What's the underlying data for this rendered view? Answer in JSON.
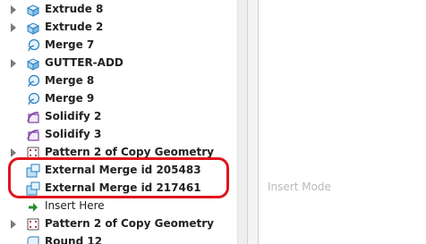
{
  "tree": {
    "rows": [
      {
        "label": "Extrude 8",
        "icon": "extrude-icon",
        "expandable": true
      },
      {
        "label": "Extrude 2",
        "icon": "extrude-icon",
        "expandable": true
      },
      {
        "label": "Merge 7",
        "icon": "merge-icon",
        "expandable": false
      },
      {
        "label": "GUTTER-ADD",
        "icon": "extrude-icon",
        "expandable": true
      },
      {
        "label": "Merge 8",
        "icon": "merge-icon",
        "expandable": false
      },
      {
        "label": "Merge 9",
        "icon": "merge-icon",
        "expandable": false
      },
      {
        "label": "Solidify 2",
        "icon": "solidify-icon",
        "expandable": false
      },
      {
        "label": "Solidify 3",
        "icon": "solidify-icon",
        "expandable": false
      },
      {
        "label": "Pattern 2 of Copy Geometry",
        "icon": "pattern-icon",
        "expandable": true
      },
      {
        "label": "External Merge id 205483",
        "icon": "external-merge-icon",
        "expandable": false
      },
      {
        "label": "External Merge id 217461",
        "icon": "external-merge-icon",
        "expandable": false
      },
      {
        "label": "Insert Here",
        "icon": "insert-arrow-icon",
        "expandable": false
      },
      {
        "label": "Pattern 2 of Copy Geometry",
        "icon": "pattern-icon",
        "expandable": true
      },
      {
        "label": "Round 12",
        "icon": "round-icon",
        "expandable": false
      }
    ]
  },
  "right_pane": {
    "insert_mode_label": "Insert Mode"
  },
  "colors": {
    "highlight": "#e0141c",
    "icon_blue": "#2a7fbf",
    "icon_purple": "#7b3fa0"
  }
}
